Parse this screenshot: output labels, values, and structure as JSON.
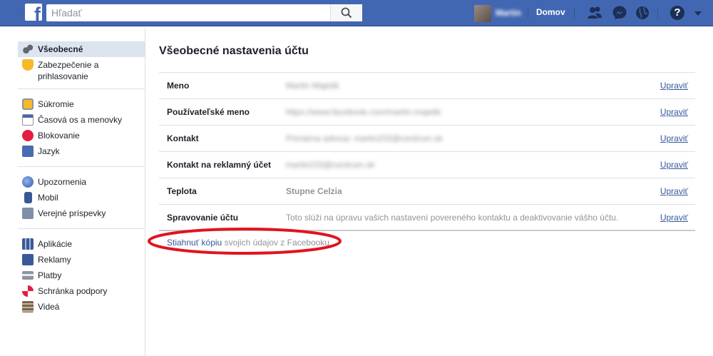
{
  "topbar": {
    "logo_letter": "f",
    "search_placeholder": "Hľadať",
    "profile_name": "Martin",
    "home_label": "Domov",
    "help_glyph": "?",
    "accent_color": "#4267b2"
  },
  "sidebar": {
    "groups": [
      [
        {
          "label": "Všeobecné",
          "icon": "gears-icon",
          "active": true
        },
        {
          "label": "Zabezpečenie a prihlasovanie",
          "icon": "shield-badge-icon"
        }
      ],
      [
        {
          "label": "Súkromie",
          "icon": "lock-icon"
        },
        {
          "label": "Časová os a menovky",
          "icon": "timeline-icon"
        },
        {
          "label": "Blokovanie",
          "icon": "block-icon"
        },
        {
          "label": "Jazyk",
          "icon": "language-icon"
        }
      ],
      [
        {
          "label": "Upozornenia",
          "icon": "globe-icon"
        },
        {
          "label": "Mobil",
          "icon": "mobile-icon"
        },
        {
          "label": "Verejné príspevky",
          "icon": "rss-icon"
        }
      ],
      [
        {
          "label": "Aplikácie",
          "icon": "apps-icon"
        },
        {
          "label": "Reklamy",
          "icon": "ads-icon"
        },
        {
          "label": "Platby",
          "icon": "credit-card-icon"
        },
        {
          "label": "Schránka podpory",
          "icon": "lifebuoy-icon"
        },
        {
          "label": "Videá",
          "icon": "film-icon"
        }
      ]
    ]
  },
  "main": {
    "title": "Všeobecné nastavenia účtu",
    "rows": [
      {
        "label": "Meno",
        "value": "Martin Majetik",
        "blurred": true,
        "edit": "Upraviť"
      },
      {
        "label": "Používateľské meno",
        "value": "https://www.facebook.com/martin.majetik",
        "blurred": true,
        "edit": "Upraviť"
      },
      {
        "label": "Kontakt",
        "value": "Primárna adresa: martin233@centrum.sk",
        "blurred": true,
        "edit": "Upraviť"
      },
      {
        "label": "Kontakt na reklamný účet",
        "value": "martin233@centrum.sk",
        "blurred": true,
        "edit": "Upraviť"
      },
      {
        "label": "Teplota",
        "value": "Stupne Celzia",
        "blurred": false,
        "strong": true,
        "edit": "Upraviť"
      },
      {
        "label": "Spravovanie účtu",
        "value": "Toto slúži na úpravu vašich nastavení povereného kontaktu a deaktivovanie vášho účtu.",
        "blurred": false,
        "edit": "Upraviť"
      }
    ],
    "download": {
      "link": "Stiahnuť kópiu",
      "rest": " svojich údajov z Facebooku",
      "highlight_color": "#e0141e"
    }
  }
}
